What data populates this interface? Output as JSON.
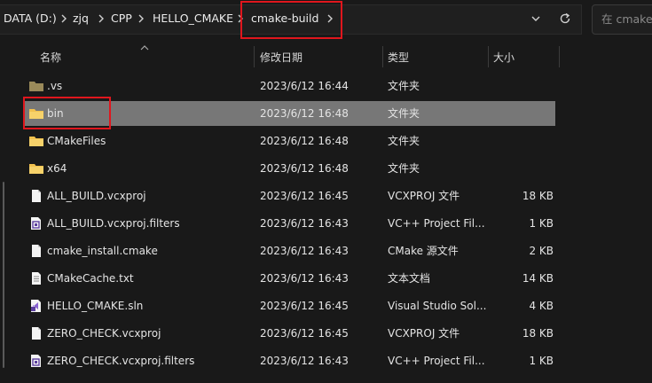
{
  "breadcrumb": [
    "DATA (D:)",
    "zjq",
    "CPP",
    "HELLO_CMAKE",
    "cmake-build"
  ],
  "search": {
    "placeholder": "在 cmake-build 中搜索"
  },
  "columns": {
    "name": "名称",
    "date": "修改日期",
    "type": "类型",
    "size": "大小"
  },
  "files": [
    {
      "name": ".vs",
      "date": "2023/6/12 16:44",
      "type": "文件夹",
      "size": "",
      "icon": "folder-dim-icon"
    },
    {
      "name": "bin",
      "date": "2023/6/12 16:48",
      "type": "文件夹",
      "size": "",
      "icon": "folder-icon"
    },
    {
      "name": "CMakeFiles",
      "date": "2023/6/12 16:48",
      "type": "文件夹",
      "size": "",
      "icon": "folder-icon"
    },
    {
      "name": "x64",
      "date": "2023/6/12 16:48",
      "type": "文件夹",
      "size": "",
      "icon": "folder-icon"
    },
    {
      "name": "ALL_BUILD.vcxproj",
      "date": "2023/6/12 16:45",
      "type": "VCXPROJ 文件",
      "size": "18 KB",
      "icon": "document-icon"
    },
    {
      "name": "ALL_BUILD.vcxproj.filters",
      "date": "2023/6/12 16:43",
      "type": "VC++ Project Fil...",
      "size": "1 KB",
      "icon": "vcxproj-filters-icon"
    },
    {
      "name": "cmake_install.cmake",
      "date": "2023/6/12 16:43",
      "type": "CMake 源文件",
      "size": "2 KB",
      "icon": "document-icon"
    },
    {
      "name": "CMakeCache.txt",
      "date": "2023/6/12 16:43",
      "type": "文本文档",
      "size": "14 KB",
      "icon": "text-file-icon"
    },
    {
      "name": "HELLO_CMAKE.sln",
      "date": "2023/6/12 16:45",
      "type": "Visual Studio Sol...",
      "size": "4 KB",
      "icon": "visual-studio-solution-icon"
    },
    {
      "name": "ZERO_CHECK.vcxproj",
      "date": "2023/6/12 16:45",
      "type": "VCXPROJ 文件",
      "size": "18 KB",
      "icon": "document-icon"
    },
    {
      "name": "ZERO_CHECK.vcxproj.filters",
      "date": "2023/6/12 16:43",
      "type": "VC++ Project Fil...",
      "size": "1 KB",
      "icon": "vcxproj-filters-icon"
    }
  ],
  "selected_index": 1,
  "colors": {
    "highlight": "#e0161d",
    "folder": "#f2c14e",
    "selection": "#777777"
  }
}
